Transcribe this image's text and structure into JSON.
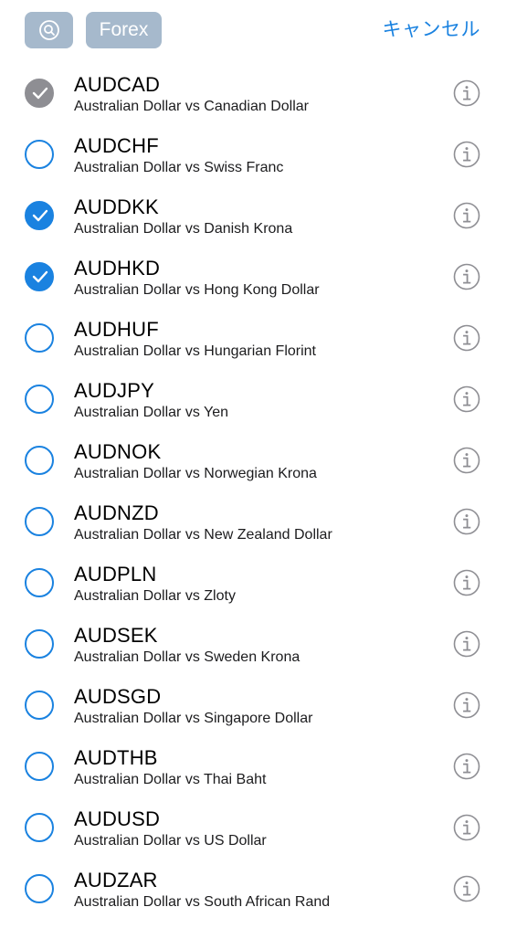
{
  "header": {
    "search_icon": "search-icon",
    "category_chip": "Forex",
    "cancel_label": "キャンセル"
  },
  "colors": {
    "accent": "#1a82e0",
    "chip_bg": "#a6b9cc",
    "disabled_check": "#8e8e93",
    "info_icon": "#8e8e93"
  },
  "items": [
    {
      "symbol": "AUDCAD",
      "description": "Australian Dollar vs Canadian Dollar",
      "state": "disabled"
    },
    {
      "symbol": "AUDCHF",
      "description": "Australian Dollar vs Swiss Franc",
      "state": "off"
    },
    {
      "symbol": "AUDDKK",
      "description": "Australian Dollar vs Danish Krona",
      "state": "on"
    },
    {
      "symbol": "AUDHKD",
      "description": "Australian Dollar vs Hong Kong Dollar",
      "state": "on"
    },
    {
      "symbol": "AUDHUF",
      "description": "Australian Dollar vs Hungarian Florint",
      "state": "off"
    },
    {
      "symbol": "AUDJPY",
      "description": "Australian Dollar vs Yen",
      "state": "off"
    },
    {
      "symbol": "AUDNOK",
      "description": "Australian Dollar vs Norwegian Krona",
      "state": "off"
    },
    {
      "symbol": "AUDNZD",
      "description": "Australian Dollar vs New Zealand Dollar",
      "state": "off"
    },
    {
      "symbol": "AUDPLN",
      "description": "Australian Dollar vs Zloty",
      "state": "off"
    },
    {
      "symbol": "AUDSEK",
      "description": "Australian Dollar vs Sweden Krona",
      "state": "off"
    },
    {
      "symbol": "AUDSGD",
      "description": "Australian Dollar vs Singapore Dollar",
      "state": "off"
    },
    {
      "symbol": "AUDTHB",
      "description": "Australian Dollar vs Thai Baht",
      "state": "off"
    },
    {
      "symbol": "AUDUSD",
      "description": "Australian Dollar vs US Dollar",
      "state": "off"
    },
    {
      "symbol": "AUDZAR",
      "description": "Australian Dollar vs South African Rand",
      "state": "off"
    }
  ]
}
